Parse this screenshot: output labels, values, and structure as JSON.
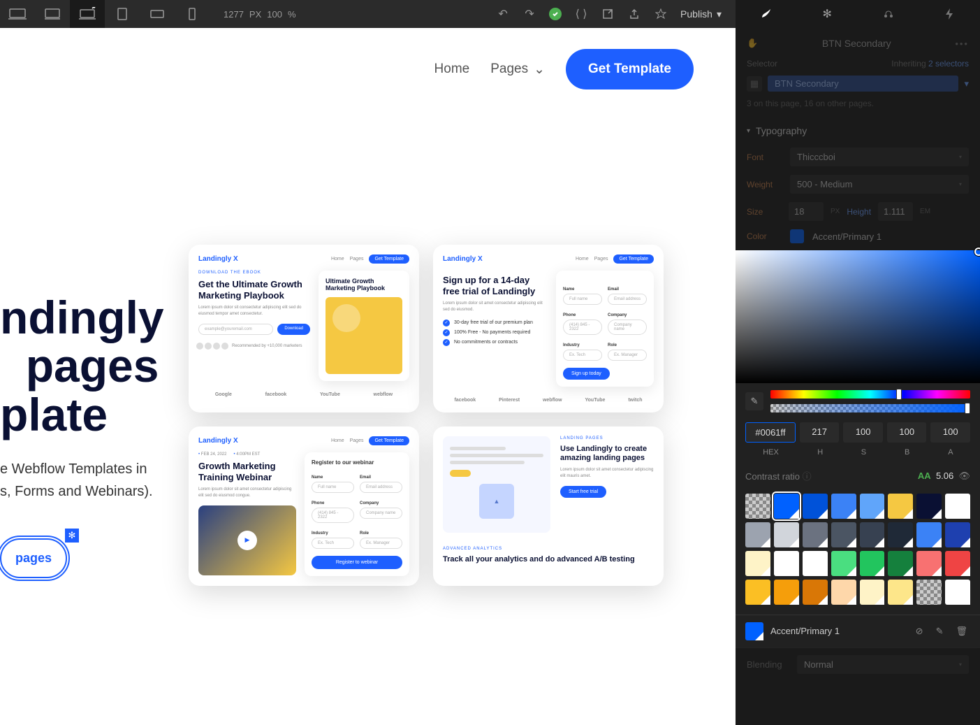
{
  "toolbar": {
    "width": "1277",
    "width_unit": "PX",
    "zoom": "100",
    "zoom_unit": "%",
    "publish": "Publish"
  },
  "site": {
    "nav": {
      "home": "Home",
      "pages": "Pages",
      "cta": "Get Template"
    },
    "hero": {
      "line1": "ndingly",
      "line2": "pages",
      "line3": "plate"
    },
    "sub1": "e Webflow Templates in",
    "sub2": "s, Forms and Webinars).",
    "btn_secondary": "pages"
  },
  "cards": {
    "brand": "Landingly X",
    "nav_home": "Home",
    "nav_pages": "Pages",
    "nav_cta": "Get Template",
    "c1": {
      "tag": "DOWNLOAD THE EBOOK",
      "title": "Get the Ultimate Growth Marketing Playbook",
      "lorem": "Lorem ipsum dolor sit consectetur adipiscing elit sed do eiusmod tempor amet consectetur.",
      "placeholder": "example@youremail.com",
      "download": "Download",
      "rec": "Recommended by +10,000 marketers",
      "playbook": "Ultimate Growth Marketing Playbook",
      "logos": [
        "Google",
        "facebook",
        "YouTube",
        "webflow"
      ]
    },
    "c2": {
      "title": "Sign up for a 14-day free trial of Landingly",
      "lorem": "Lorem ipsum dolor sit amet consectetur adipiscing elit sed do eiusmod.",
      "b1": "30-day free trial of our premium plan",
      "b2": "100% Free - No payments required",
      "b3": "No commitments or contracts",
      "fields": {
        "name": "Name",
        "name_ph": "Full name",
        "email": "Email",
        "email_ph": "Email address",
        "phone": "Phone",
        "phone_ph": "(414) 845 - 2322",
        "company": "Company",
        "company_ph": "Company name",
        "industry": "Industry",
        "industry_ph": "Ex. Tech",
        "role": "Role",
        "role_ph": "Ex. Manager"
      },
      "cta": "Sign up today",
      "logos": [
        "facebook",
        "Pinterest",
        "webflow",
        "YouTube",
        "twitch"
      ]
    },
    "c3": {
      "date": "FEB 24, 2022",
      "time": "4:00PM EST",
      "title": "Growth Marketing Training Webinar",
      "lorem": "Lorem ipsum dolor sit amet consectetur adipiscing elit sed do eiusmod congue.",
      "form_title": "Register to our webinar",
      "cta": "Register to webinar"
    },
    "c4": {
      "tag1": "LANDING PAGES",
      "title1": "Use Landingly to create amazing landing pages",
      "lorem1": "Lorem ipsum dolor sit amet consectetur adipiscing elit mauris amet.",
      "cta1": "Start free trial",
      "tag2": "ADVANCED ANALYTICS",
      "title2": "Track all your analytics and do advanced A/B testing"
    }
  },
  "panel": {
    "class_name": "BTN Secondary",
    "selector_label": "Selector",
    "inheriting": "Inheriting",
    "inheriting_count": "2 selectors",
    "selector_tag": "BTN Secondary",
    "count": "3 on this page, 16 on other pages.",
    "typography": "Typography",
    "font_label": "Font",
    "font_value": "Thicccboi",
    "weight_label": "Weight",
    "weight_value": "500 - Medium",
    "size_label": "Size",
    "size_value": "18",
    "size_unit": "PX",
    "height_label": "Height",
    "height_value": "1.111",
    "height_unit": "EM",
    "color_label": "Color",
    "color_name": "Accent/Primary 1",
    "hex": "#0061ff",
    "h": "217",
    "s": "100",
    "b": "100",
    "a": "100",
    "hex_label": "HEX",
    "h_label": "H",
    "s_label": "S",
    "b_label": "B",
    "a_label": "A",
    "contrast_label": "Contrast ratio",
    "contrast_aa": "AA",
    "contrast_value": "5.06",
    "current_swatch": "Accent/Primary 1",
    "blending_label": "Blending",
    "blending_value": "Normal",
    "swatches": [
      "checker",
      "#0061ff",
      "#0052d9",
      "#3b82f6",
      "#60a5fa",
      "#f5c842",
      "#0a1033",
      "#ffffff",
      "#9ca3af",
      "#d1d5db",
      "#6b7280",
      "#4b5563",
      "#374151",
      "#1f2937",
      "#3b82f6",
      "#1e40af",
      "#fef3c7",
      "#ffffff",
      "#ffffff",
      "#4ade80",
      "#22c55e",
      "#15803d",
      "#f87171",
      "#ef4444",
      "#fbbf24",
      "#f59e0b",
      "#d97706",
      "#fed7aa",
      "#fef3c7",
      "#fde68a",
      "checker",
      "#ffffff"
    ]
  }
}
